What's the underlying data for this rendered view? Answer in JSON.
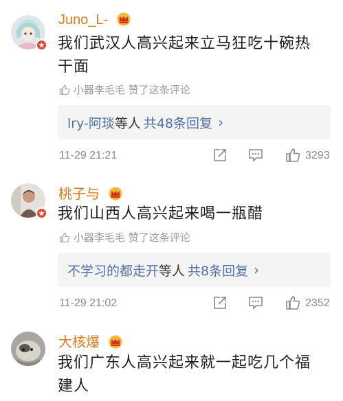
{
  "comments": [
    {
      "username": "Juno_L-",
      "text_line1": "我们武汉人高兴起来立马狂吃十碗热",
      "text_line2": "干面",
      "liked_by": "小器李毛毛 赞了这条评论",
      "reply_user": "lry-阿琰",
      "reply_mid": "等人",
      "reply_count": "共48条回复",
      "reply_arrow": "›",
      "time": "11-29 21:21",
      "likes": "3293"
    },
    {
      "username": "桃子与",
      "text_line1": "我们山西人高兴起来喝一瓶醋",
      "liked_by": "小器李毛毛 赞了这条评论",
      "reply_user": "不学习的都走开",
      "reply_mid": "等人",
      "reply_count": "共8条回复",
      "reply_arrow": "›",
      "time": "11-29 21:02",
      "likes": "2352"
    },
    {
      "username": "大核爆",
      "text_line1": "我们广东人高兴起来就一起吃几个福",
      "text_line2": "建人"
    }
  ],
  "colors": {
    "username": "#e07b1e",
    "link": "#4f73a8",
    "verified_badge": "#e8402a",
    "meta": "#9a9a9a"
  },
  "icons": [
    "crown-vip-icon",
    "thumbs-up-icon",
    "share-icon",
    "comment-icon",
    "like-icon"
  ]
}
